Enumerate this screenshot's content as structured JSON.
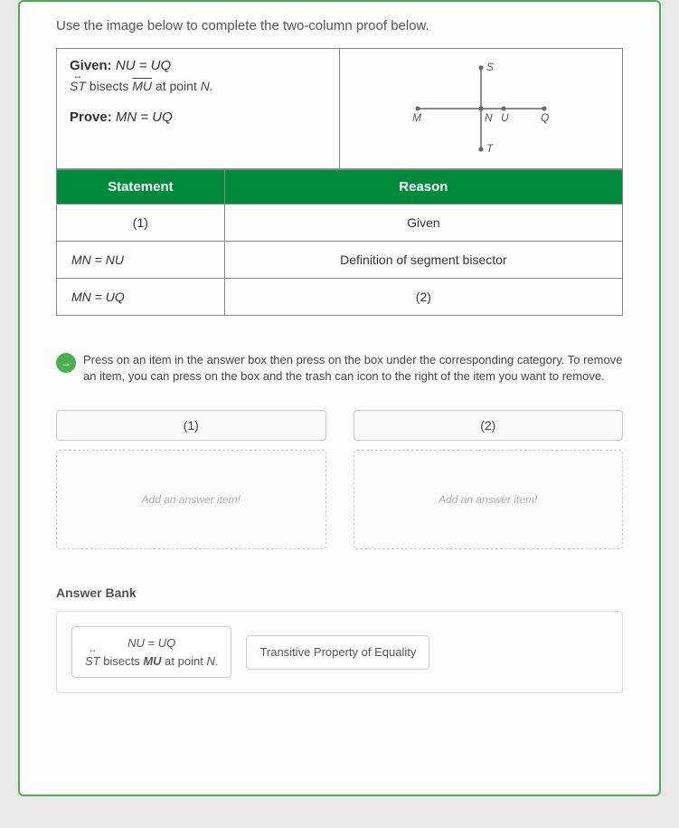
{
  "instruction": "Use the image below to complete the two-column proof below.",
  "given": {
    "label": "Given:",
    "statement": "NU = UQ",
    "bisect": "S̅T̅ bisects M̅U̅ at point N."
  },
  "prove": {
    "label": "Prove:",
    "statement": "MN = UQ"
  },
  "diagram": {
    "S": "S",
    "M": "M",
    "N": "N",
    "U": "U",
    "Q": "Q",
    "T": "T"
  },
  "table": {
    "headers": {
      "statement": "Statement",
      "reason": "Reason"
    },
    "rows": [
      {
        "statement": "(1)",
        "reason": "Given",
        "statement_align": "center"
      },
      {
        "statement": "MN = NU",
        "reason": "Definition of segment bisector",
        "statement_align": "left"
      },
      {
        "statement": "MN = UQ",
        "reason": "(2)",
        "statement_align": "left"
      }
    ]
  },
  "hint": {
    "icon": "→",
    "text": "Press on an item in the answer box then press on the box under the corresponding category. To remove an item, you can press on the box and the trash can icon to the right of the item you want to remove."
  },
  "drop": {
    "cols": [
      {
        "header": "(1)",
        "placeholder": "Add an answer item!"
      },
      {
        "header": "(2)",
        "placeholder": "Add an answer item!"
      }
    ]
  },
  "bank": {
    "title": "Answer Bank",
    "items": [
      {
        "line1": "NU = UQ",
        "line2": "S̅T̅ bisects M̅U̅ at point N."
      },
      {
        "line1": "Transitive Property of Equality",
        "line2": ""
      }
    ]
  }
}
